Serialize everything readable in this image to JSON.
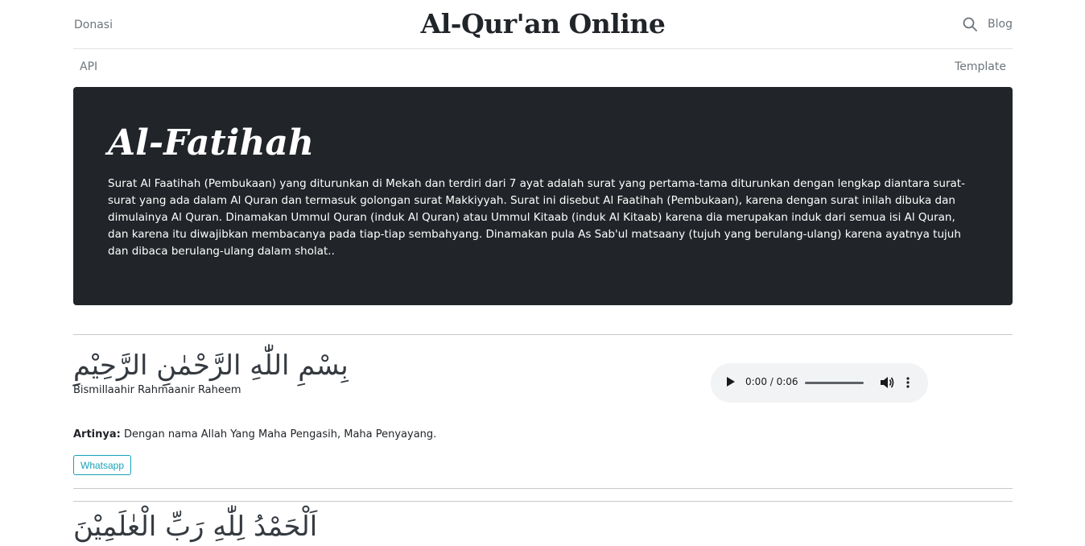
{
  "header": {
    "donasi": "Donasi",
    "title": "Al-Qur'an Online",
    "blog": "Blog"
  },
  "nav": {
    "api": "API",
    "template": "Template"
  },
  "surah": {
    "name": "Al-Fatihah",
    "description": "Surat Al Faatihah (Pembukaan) yang diturunkan di Mekah dan terdiri dari 7 ayat adalah surat yang pertama-tama diturunkan dengan lengkap diantara surat-surat yang ada dalam Al Quran dan termasuk golongan surat Makkiyyah. Surat ini disebut Al Faatihah (Pembukaan), karena dengan surat inilah dibuka dan dimulainya Al Quran. Dinamakan Ummul Quran (induk Al Quran) atau Ummul Kitaab (induk Al Kitaab) karena dia merupakan induk dari semua isi Al Quran, dan karena itu diwajibkan membacanya pada tiap-tiap sembahyang. Dinamakan pula As Sab'ul matsaany (tujuh yang berulang-ulang) karena ayatnya tujuh dan dibaca berulang-ulang dalam sholat.."
  },
  "ayat": [
    {
      "arab": "بِسْمِ اللّٰهِ الرَّحْمٰنِ الرَّحِيْمِ",
      "latin": "Bismillaahir Rahmaanir Raheem",
      "artinya_label": "Artinya:",
      "artinya": "Dengan nama Allah Yang Maha Pengasih, Maha Penyayang.",
      "share_label": "Whatsapp",
      "audio_time": "0:00 / 0:06"
    },
    {
      "arab": "اَلْحَمْدُ لِلّٰهِ رَبِّ الْعٰلَمِيْنَ"
    }
  ],
  "icons": {
    "search": "search-icon",
    "play": "play-icon",
    "volume": "volume-icon",
    "more": "more-vertical-icon"
  },
  "colors": {
    "hero_bg": "#212529",
    "accent": "#17a2b8"
  }
}
